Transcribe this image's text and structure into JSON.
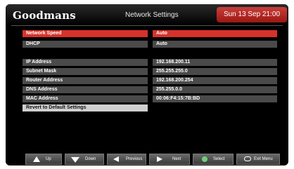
{
  "header": {
    "brand": "Goodmans",
    "title": "Network Settings",
    "datetime": "Sun 13 Sep  21:00"
  },
  "settings": [
    {
      "label": "Network Speed",
      "value": "Auto"
    },
    {
      "label": "DHCP",
      "value": "Auto"
    },
    {
      "label": "IP Address",
      "value": "192.168.200.11"
    },
    {
      "label": "Subnet Mask",
      "value": "255.255.255.0"
    },
    {
      "label": "Router Address",
      "value": "192.168.200.254"
    },
    {
      "label": "DNS Address",
      "value": "255.255.0.0"
    },
    {
      "label": "MAC Address",
      "value": "00:06:F4:15:7B:BD"
    }
  ],
  "revert_label": "Revert to Default Settings",
  "nav": {
    "up": "Up",
    "down": "Down",
    "previous": "Previous",
    "next": "Next",
    "select": "Select",
    "exit": "Exit Menu"
  },
  "colors": {
    "accent": "#d6322c",
    "row_bg": "#4a4a4a",
    "background": "#000000"
  }
}
